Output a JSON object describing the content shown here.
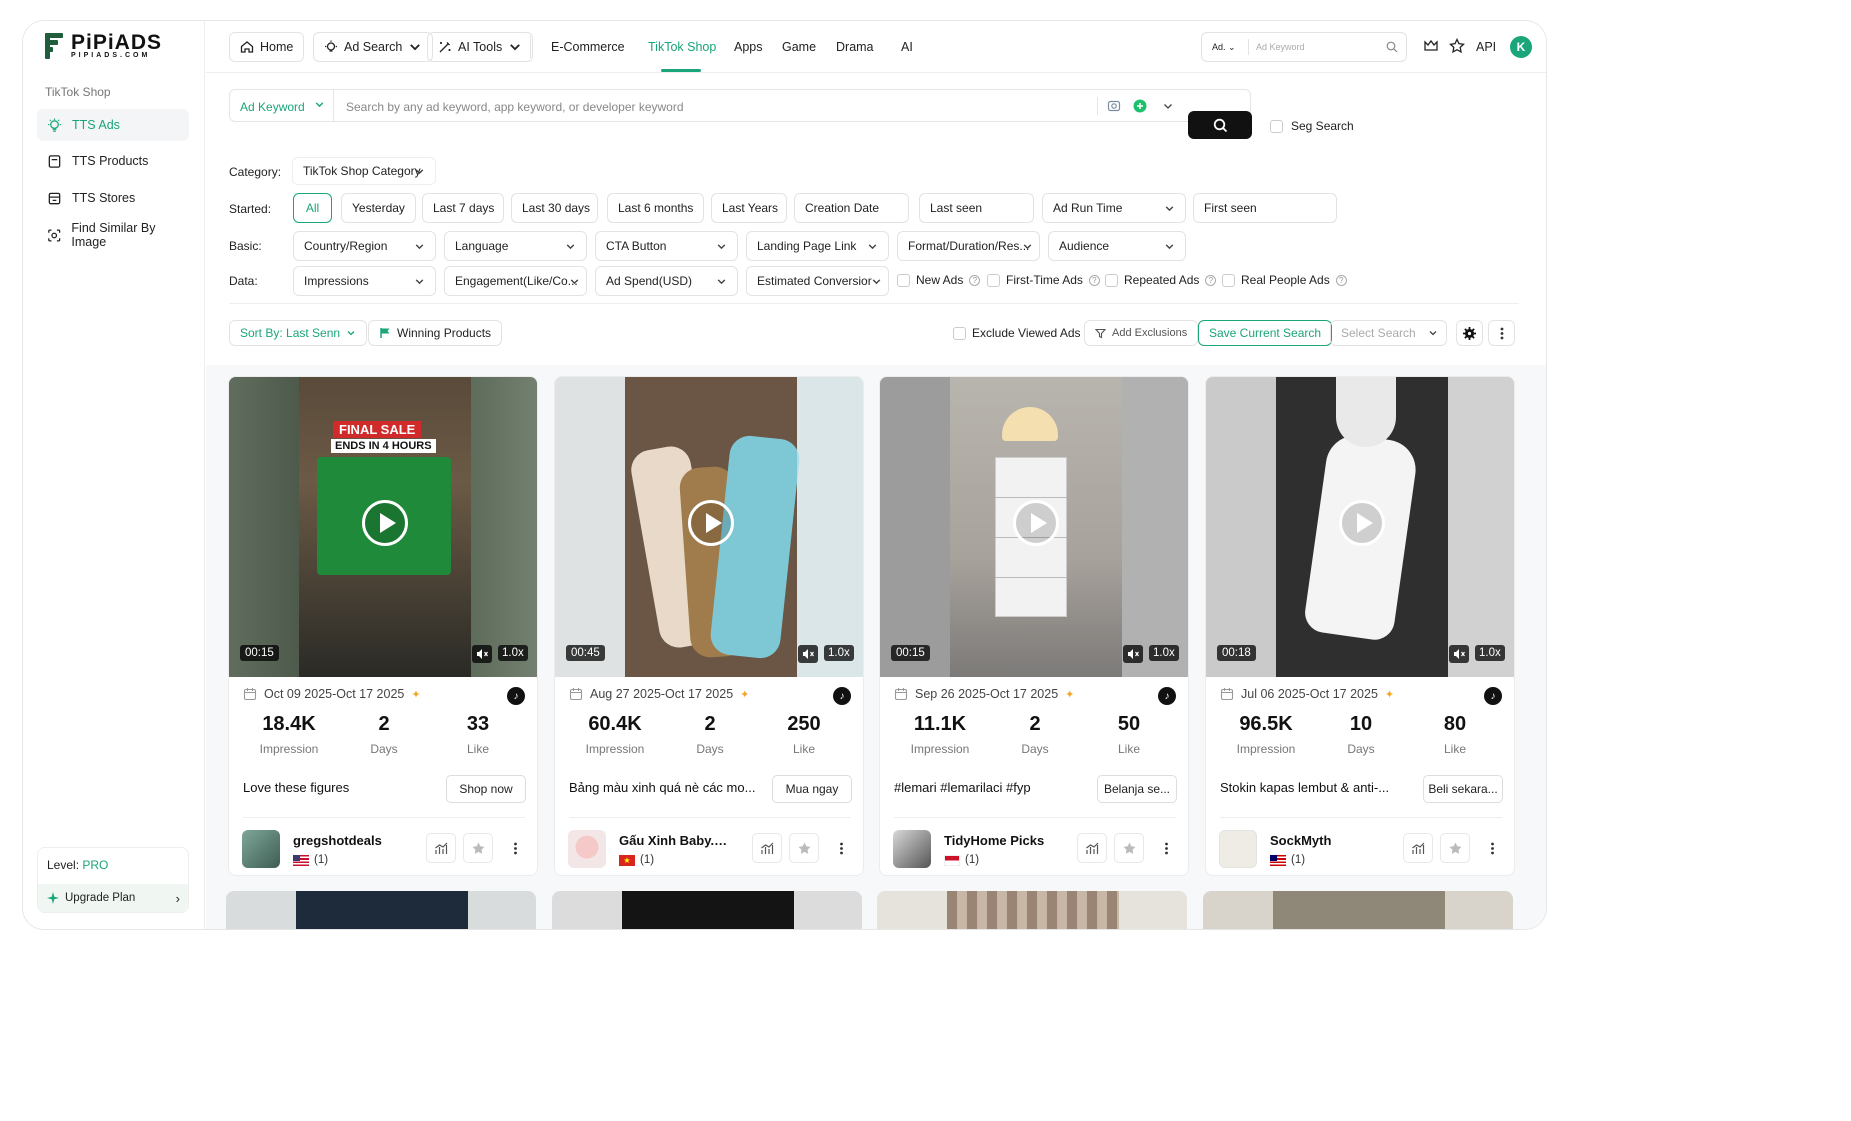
{
  "brand": {
    "name": "PiPiADS",
    "sub": "PIPIADS.COM"
  },
  "sidebar": {
    "section": "TikTok Shop",
    "items": [
      {
        "label": "TTS Ads",
        "icon": "bulb-icon"
      },
      {
        "label": "TTS Products",
        "icon": "product-icon"
      },
      {
        "label": "TTS Stores",
        "icon": "store-icon"
      },
      {
        "label": "Find Similar By Image",
        "icon": "image-search-icon"
      }
    ],
    "level_label": "Level:",
    "level_value": "PRO",
    "upgrade": "Upgrade Plan"
  },
  "topbar": {
    "home": "Home",
    "ad_search": "Ad Search",
    "ai_tools": "AI Tools",
    "links": [
      "E-Commerce",
      "TikTok Shop",
      "Apps",
      "Game",
      "Drama",
      "AI"
    ],
    "active_link": "TikTok Shop",
    "search_select": "Ad.",
    "search_placeholder": "Ad Keyword",
    "api": "API",
    "avatar": "K"
  },
  "search": {
    "type": "Ad Keyword",
    "placeholder": "Search by any ad keyword, app keyword, or developer keyword",
    "seg_search": "Seg Search"
  },
  "filters": {
    "category_label": "Category:",
    "category_value": "TikTok Shop Category",
    "started_label": "Started:",
    "started": [
      "All",
      "Yesterday",
      "Last 7 days",
      "Last 30 days",
      "Last 6 months",
      "Last Years",
      "Creation Date",
      "Last seen",
      "Ad Run Time",
      "First seen"
    ],
    "basic_label": "Basic:",
    "basic": [
      "Country/Region",
      "Language",
      "CTA Button",
      "Landing Page Link",
      "Format/Duration/Res...",
      "Audience"
    ],
    "data_label": "Data:",
    "data": [
      "Impressions",
      "Engagement(Like/Co...",
      "Ad Spend(USD)",
      "Estimated Conversior"
    ],
    "checks": [
      "New Ads",
      "First-Time Ads",
      "Repeated Ads",
      "Real People Ads"
    ]
  },
  "sortbar": {
    "sort": "Sort By: Last Senn",
    "winning": "Winning Products",
    "exclude_viewed": "Exclude Viewed Ads",
    "add_exclusions": "Add Exclusions",
    "save_search": "Save Current Search",
    "select_search": "Select Search"
  },
  "cards": [
    {
      "duration": "00:15",
      "speed": "1.0x",
      "date": "Oct 09 2025-Oct 17 2025",
      "impression": "18.4K",
      "days": "2",
      "like": "33",
      "impression_label": "Impression",
      "days_label": "Days",
      "like_label": "Like",
      "caption": "Love these figures",
      "cta": "Shop now",
      "advertiser": "gregshotdeals",
      "count": "(1)",
      "overlay1": "FINAL SALE",
      "overlay2": "ENDS IN 4 HOURS",
      "colors": {
        "bg": "#3b4a3c",
        "center": "#5a4a3a",
        "accent": "#1f8a3a"
      }
    },
    {
      "duration": "00:45",
      "speed": "1.0x",
      "date": "Aug 27 2025-Oct 17 2025",
      "impression": "60.4K",
      "days": "2",
      "like": "250",
      "impression_label": "Impression",
      "days_label": "Days",
      "like_label": "Like",
      "caption": "Bảng màu xinh quá nè các mo...",
      "cta": "Mua ngay",
      "advertiser": "Gấu Xinh Baby.me...",
      "count": "(1)",
      "colors": {
        "bg": "#d8dcdc",
        "center": "#6b5646",
        "accent": "#7ec8d6"
      }
    },
    {
      "duration": "00:15",
      "speed": "1.0x",
      "date": "Sep 26 2025-Oct 17 2025",
      "impression": "11.1K",
      "days": "2",
      "like": "50",
      "impression_label": "Impression",
      "days_label": "Days",
      "like_label": "Like",
      "caption": "#lemari #lemarilaci #fyp",
      "cta": "Belanja se...",
      "advertiser": "TidyHome Picks",
      "count": "(1)",
      "colors": {
        "bg": "#9a9a9a",
        "center": "#8f8a86",
        "accent": "#f2f2f2"
      }
    },
    {
      "duration": "00:18",
      "speed": "1.0x",
      "date": "Jul 06 2025-Oct 17 2025",
      "impression": "96.5K",
      "days": "10",
      "like": "80",
      "impression_label": "Impression",
      "days_label": "Days",
      "like_label": "Like",
      "caption": "Stokin kapas lembut & anti-...",
      "cta": "Beli sekara...",
      "advertiser": "SockMyth",
      "count": "(1)",
      "colors": {
        "bg": "#c9c9c9",
        "center": "#3a3a3a",
        "accent": "#f4f4f4"
      }
    }
  ]
}
